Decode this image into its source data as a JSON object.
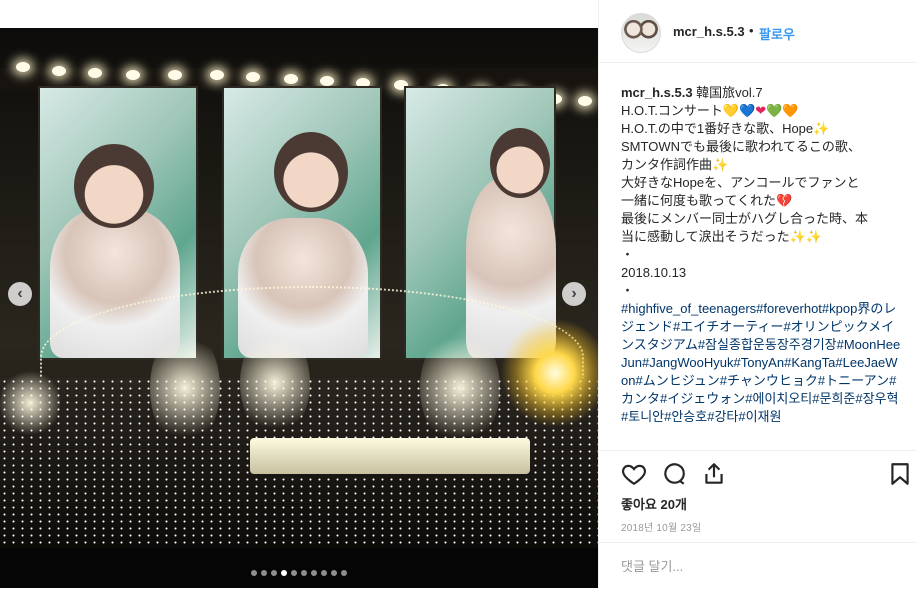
{
  "post": {
    "username": "mcr_h.s.5.3",
    "separator": "•",
    "follow_label": "팔로우",
    "caption_username": "mcr_h.s.5.3",
    "caption_lines": [
      "韓国旅vol.7",
      "H.O.T.コンサート",
      "H.O.T.の中で1番好きな歌、Hope",
      "SMTOWNでも最後に歌われてるこの歌、",
      "カンタ作詞作曲",
      "大好きなHopeを、アンコールでファンと",
      "一緒に何度も歌ってくれた",
      "最後にメンバー同士がハグし合った時、本",
      "当に感動して涙出そうだった",
      "・",
      "2018.10.13",
      "・"
    ],
    "hearts": [
      "💛",
      "💙",
      "❤",
      "💚",
      "🧡"
    ],
    "hashtags": "#highfive_of_teenagers#foreverhot#kpop界のレジェンド#エイチオーティー#オリンピックメインスタジアム#잠실종합운동장주경기장#MoonHeeJun#JangWooHyuk#TonyAn#KangTa#LeeJaeWon#ムンヒジュン#チャンウヒョク#トニーアン#カンタ#イジェウォン#에이치오티#문희준#장우혁#토니안#안승호#강타#이재원",
    "likes": "좋아요 20개",
    "date": "2018년 10월 23일",
    "comment_placeholder": "댓글 달기..."
  },
  "carousel": {
    "prev_icon": "‹",
    "next_icon": "›",
    "total_slides": 10,
    "active_index": 3
  },
  "colors": {
    "link": "#3897f0",
    "hashtag": "#003569",
    "broken_heart": "#e0245e"
  }
}
